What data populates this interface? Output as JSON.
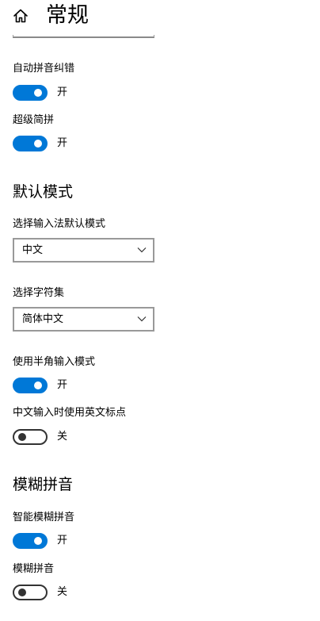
{
  "header": {
    "title": "常规",
    "home_icon": "home-icon"
  },
  "accent_color": "#0078d7",
  "settings": {
    "auto_correct": {
      "label": "自动拼音纠错",
      "state": "开",
      "on": true
    },
    "super_jianpin": {
      "label": "超级简拼",
      "state": "开",
      "on": true
    }
  },
  "default_mode": {
    "heading": "默认模式",
    "ime_mode": {
      "label": "选择输入法默认模式",
      "value": "中文"
    },
    "charset": {
      "label": "选择字符集",
      "value": "简体中文"
    },
    "half_width": {
      "label": "使用半角输入模式",
      "state": "开",
      "on": true
    },
    "english_punct": {
      "label": "中文输入时使用英文标点",
      "state": "关",
      "on": false
    }
  },
  "fuzzy_pinyin": {
    "heading": "模糊拼音",
    "smart_fuzzy": {
      "label": "智能模糊拼音",
      "state": "开",
      "on": true
    },
    "fuzzy": {
      "label": "模糊拼音",
      "state": "关",
      "on": false
    }
  }
}
